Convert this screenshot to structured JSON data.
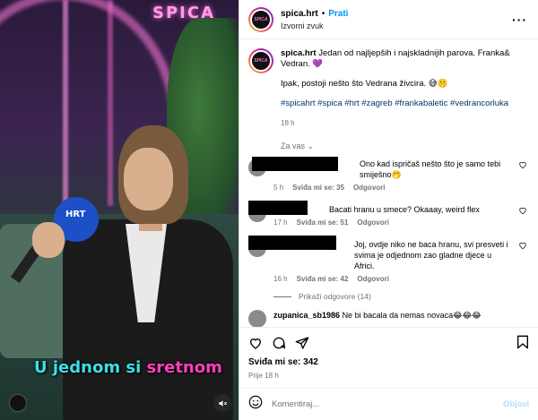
{
  "video": {
    "subtitle_word1": "U jednom si",
    "subtitle_word2": "sretnom",
    "neon_logo": "SPICA",
    "mic_label": "HRT"
  },
  "header": {
    "username": "spica.hrt",
    "follow_label": "Prati",
    "audio_label": "Izvorni zvuk",
    "more_icon": "more-horizontal-icon"
  },
  "caption": {
    "username": "spica.hrt",
    "line1": "Jedan od najljepših i najskladnijih parova. Franka& Vedran. 💜",
    "line2": "Ipak, postoji nešto što Vedrana živcira. 😅🤫",
    "hashtags": "#spicahrt #spica #hrt #zagreb #frankabaletic #vedrancorluka",
    "time": "18 h"
  },
  "filter_label": "Za vas ⌄",
  "comments": [
    {
      "text": "Ono kad ispričaš nešto što je samo tebi smiješno🤭",
      "time": "5 h",
      "likes": "Sviđa mi se: 35",
      "reply": "Odgovori"
    },
    {
      "text": "Bacati hranu u smece? Okaaay, weird flex",
      "time": "17 h",
      "likes": "Sviđa mi se: 51",
      "reply": "Odgovori"
    },
    {
      "text": "Joj, ovdje niko ne baca hranu, svi presveti i svima je odjednom zao gladne djece u Africi.",
      "time": "16 h",
      "likes": "Sviđa mi se: 42",
      "reply": "Odgovori",
      "show_replies": "Prikaži odgovore (14)"
    },
    {
      "username": "zupanica_sb1986",
      "text": "Ne bi bacala da nemas novaca😂😂😂"
    }
  ],
  "footer": {
    "likes": "Sviđa mi se: 342",
    "time": "Prije 18 h",
    "comment_placeholder": "Komentiraj...",
    "post_label": "Objavi"
  },
  "colors": {
    "link_blue": "#0095f6",
    "hashtag_blue": "#00376b",
    "muted_gray": "#737373",
    "subtitle_cyan": "#39e0e8",
    "subtitle_pink": "#ff3fbf"
  }
}
